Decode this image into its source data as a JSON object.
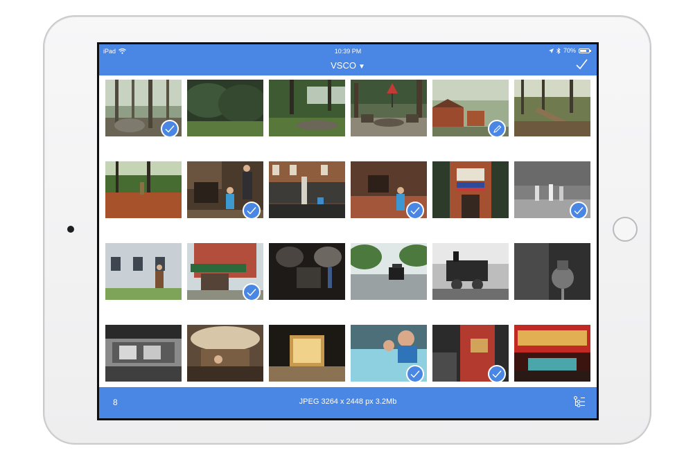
{
  "device": {
    "status_device": "iPad",
    "status_time": "10:39 PM",
    "battery_percent": "70%"
  },
  "header": {
    "album_title": "VSCO",
    "album_chevron": "▼",
    "done_icon": "checkmark-icon"
  },
  "footer": {
    "selected_count": "8",
    "file_info": "JPEG 3264 x 2448 px 3.2Mb",
    "adjust_icon": "adjustments-icon"
  },
  "colors": {
    "accent": "#4a86e3",
    "badge_border": "#ffffff"
  },
  "photos": [
    {
      "badge": "check"
    },
    {
      "badge": "none"
    },
    {
      "badge": "none"
    },
    {
      "badge": "none"
    },
    {
      "badge": "edit"
    },
    {
      "badge": "none"
    },
    {
      "badge": "none"
    },
    {
      "badge": "check"
    },
    {
      "badge": "none"
    },
    {
      "badge": "check"
    },
    {
      "badge": "none"
    },
    {
      "badge": "check"
    },
    {
      "badge": "none"
    },
    {
      "badge": "check"
    },
    {
      "badge": "none"
    },
    {
      "badge": "none"
    },
    {
      "badge": "none"
    },
    {
      "badge": "none"
    },
    {
      "badge": "none"
    },
    {
      "badge": "none"
    },
    {
      "badge": "none"
    },
    {
      "badge": "check"
    },
    {
      "badge": "check"
    },
    {
      "badge": "none"
    }
  ]
}
